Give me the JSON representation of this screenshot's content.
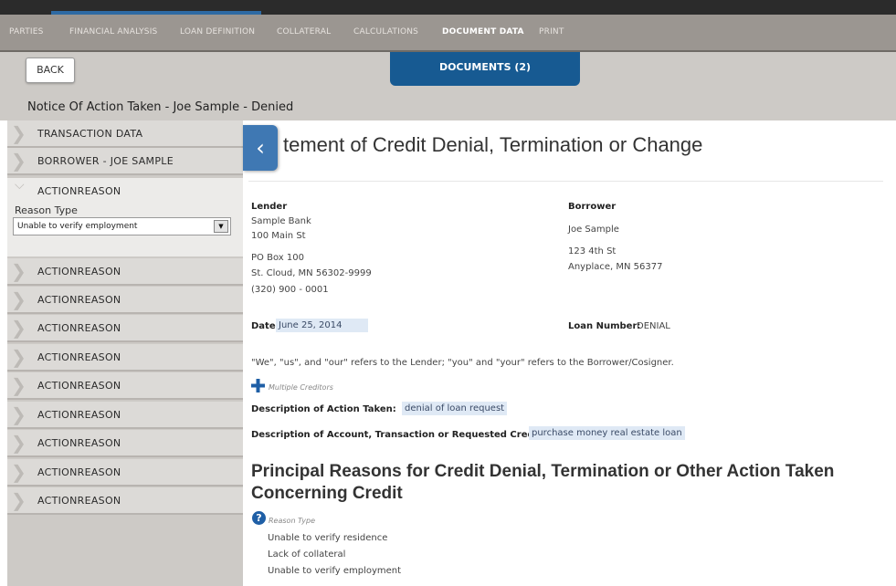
{
  "nav": {
    "tabs": [
      {
        "label": "PARTIES"
      },
      {
        "label": "FINANCIAL ANALYSIS"
      },
      {
        "label": "LOAN DEFINITION"
      },
      {
        "label": "COLLATERAL"
      },
      {
        "label": "CALCULATIONS"
      },
      {
        "label": "DOCUMENT DATA",
        "active": true
      },
      {
        "label": "PRINT"
      }
    ]
  },
  "toolbar": {
    "back_label": "BACK",
    "documents_tab": "DOCUMENTS (2)"
  },
  "page_title": "Notice Of Action Taken - Joe Sample - Denied",
  "sidebar": {
    "items": [
      {
        "label": "TRANSACTION DATA"
      },
      {
        "label": "BORROWER - JOE SAMPLE"
      }
    ],
    "expanded": {
      "label": "ACTIONREASON",
      "reason_type_label": "Reason Type",
      "reason_type_value": "Unable to verify employment"
    },
    "collapsed_reasons": [
      "ACTIONREASON",
      "ACTIONREASON",
      "ACTIONREASON",
      "ACTIONREASON",
      "ACTIONREASON",
      "ACTIONREASON",
      "ACTIONREASON",
      "ACTIONREASON",
      "ACTIONREASON"
    ]
  },
  "document": {
    "heading": "tement of Credit Denial, Termination or Change",
    "lender": {
      "label": "Lender",
      "name": "Sample Bank",
      "street": "100 Main St",
      "po": "PO Box 100",
      "city": "St. Cloud, MN 56302-9999",
      "phone": "(320) 900 - 0001"
    },
    "borrower": {
      "label": "Borrower",
      "name": "Joe Sample",
      "street": "123 4th St",
      "city": "Anyplace, MN 56377"
    },
    "date_label": "Date:",
    "date_value": "June 25, 2014",
    "loan_number_label": "Loan Number:",
    "loan_number_value": "DENIAL",
    "definitions": "\"We\", \"us\", and \"our\" refers to the Lender; \"you\" and \"your\" refers to the Borrower/Cosigner.",
    "multiple_creditors": "Multiple Creditors",
    "action_taken_label": "Description of Action Taken:",
    "action_taken_value": "denial of loan request",
    "account_label": "Description of Account, Transaction or Requested Credit:",
    "account_value": "purchase money real estate loan",
    "principal_title": "Principal Reasons for Credit Denial, Termination or Other Action Taken Concerning Credit",
    "reason_type_small": "Reason Type",
    "reasons": [
      "Unable to verify residence",
      "Lack of collateral",
      "Unable to verify employment"
    ]
  },
  "icons": {
    "collapse": "chevron-left-icon",
    "add": "plus-icon",
    "help": "help-icon",
    "dropdown": "caret-down-icon"
  },
  "colors": {
    "accent": "#175a92",
    "nav_bg": "#9b9691",
    "sidebar_bg": "#cdcac6"
  }
}
